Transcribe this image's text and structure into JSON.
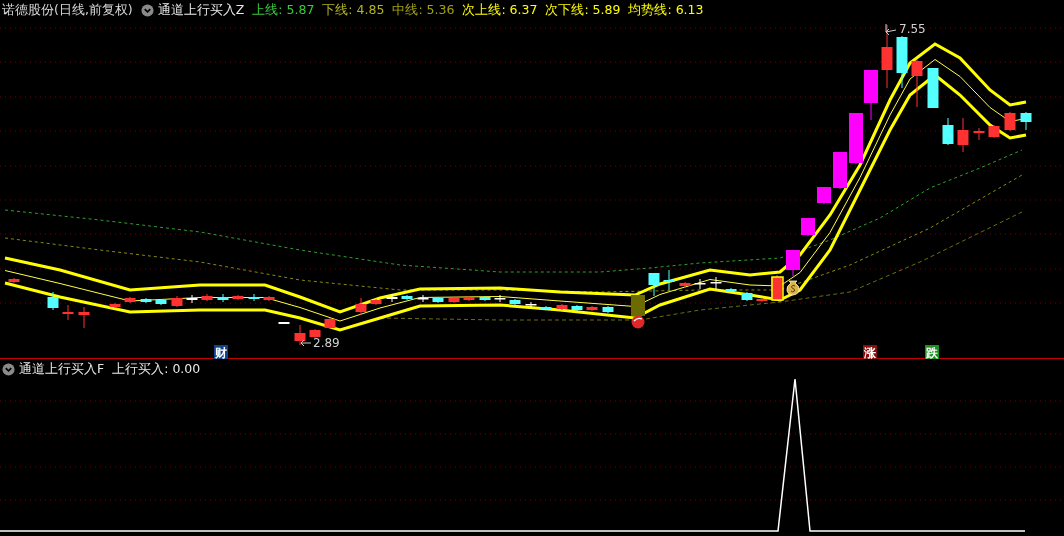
{
  "main_pane": {
    "title": "诺德股份(日线,前复权)",
    "indicator": "通道上行买入Z",
    "readings": [
      {
        "text": "上线: 5.87",
        "color": "#3cc83c"
      },
      {
        "text": "下线: 4.85",
        "color": "#b4b428"
      },
      {
        "text": "中线: 5.36",
        "color": "#a0a014"
      },
      {
        "text": "次上线: 6.37",
        "color": "#ffff00"
      },
      {
        "text": "次下线: 5.89",
        "color": "#ffff00"
      },
      {
        "text": "均势线: 6.13",
        "color": "#ffff00"
      }
    ],
    "high_label": "7.55",
    "low_label": "2.89",
    "event_tags": [
      {
        "text": "财",
        "color": "#12418a"
      },
      {
        "text": "涨",
        "color": "#8a0c0c"
      },
      {
        "text": "跌",
        "color": "#1e9020"
      }
    ]
  },
  "sub_pane": {
    "indicator": "通道上行买入F",
    "reading": "上行买入: 0.00"
  }
}
